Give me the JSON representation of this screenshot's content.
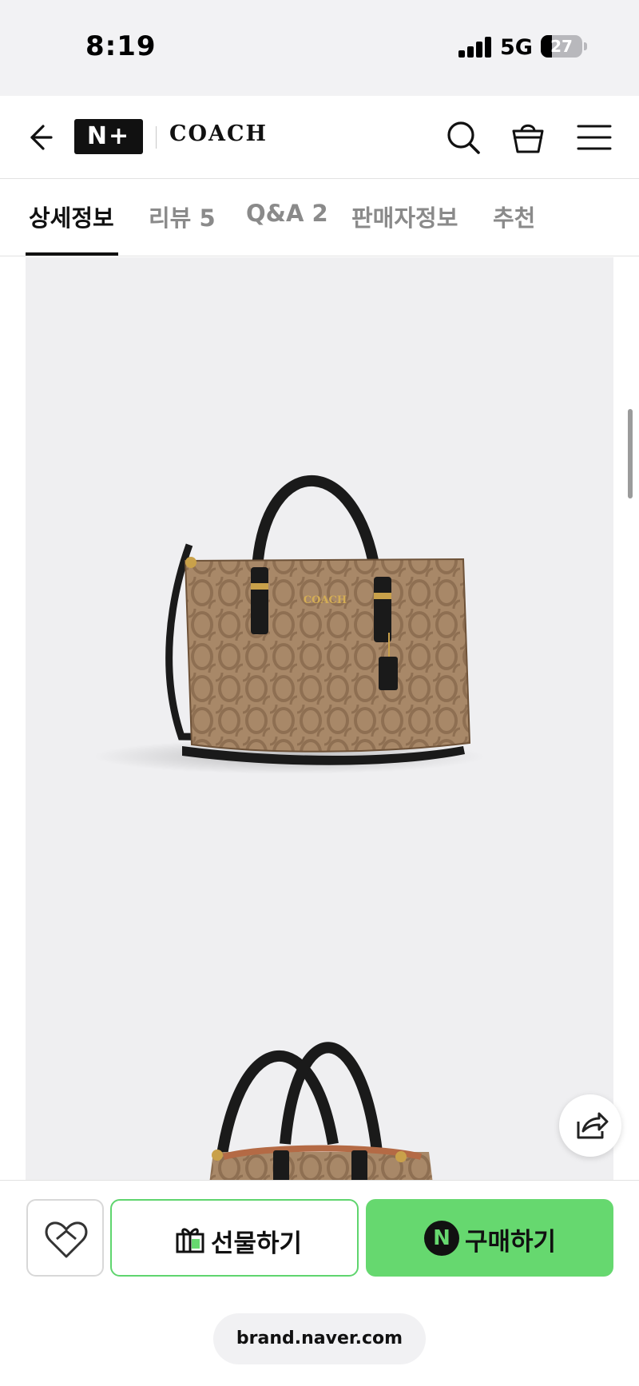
{
  "status": {
    "time": "8:19",
    "network": "5G",
    "battery": "27",
    "battery_level": 0.27
  },
  "header": {
    "logo_mark": "N+",
    "brand": "COACH",
    "icons": [
      "back-arrow-icon",
      "search-icon",
      "shopping-bag-icon",
      "menu-icon"
    ]
  },
  "tabs": [
    {
      "label": "상세정보",
      "active": true
    },
    {
      "label": "리뷰 5",
      "active": false
    },
    {
      "label": "Q&A 2",
      "active": false
    },
    {
      "label": "판매자정보",
      "active": false
    },
    {
      "label": "추천",
      "active": false
    }
  ],
  "product": {
    "hardware_label": "COACH"
  },
  "actions": {
    "gift_label": "선물하기",
    "buy_label": "구매하기",
    "buy_badge": "N"
  },
  "browser": {
    "url": "brand.naver.com"
  },
  "colors": {
    "buy_green": "#66d86f",
    "gift_border": "#5fd56e",
    "image_bg": "#efeff1",
    "bag_tan": "#a88868",
    "bag_strap": "#1a1a1a"
  }
}
